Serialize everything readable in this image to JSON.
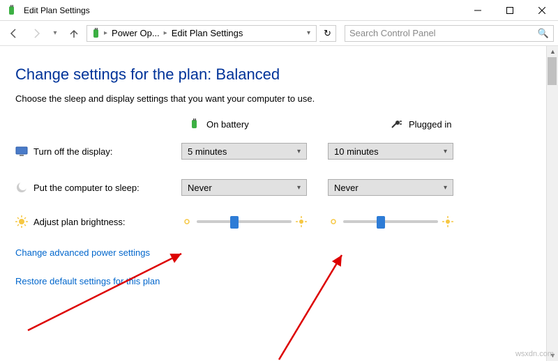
{
  "window": {
    "title": "Edit Plan Settings"
  },
  "breadcrumb": {
    "item1": "Power Op...",
    "item2": "Edit Plan Settings"
  },
  "search": {
    "placeholder": "Search Control Panel"
  },
  "heading": "Change settings for the plan: Balanced",
  "subtext": "Choose the sleep and display settings that you want your computer to use.",
  "columns": {
    "battery": "On battery",
    "plugged": "Plugged in"
  },
  "rows": {
    "display": {
      "label": "Turn off the display:",
      "battery": "5 minutes",
      "plugged": "10 minutes"
    },
    "sleep": {
      "label": "Put the computer to sleep:",
      "battery": "Never",
      "plugged": "Never"
    },
    "brightness": {
      "label": "Adjust plan brightness:"
    }
  },
  "links": {
    "advanced": "Change advanced power settings",
    "restore": "Restore default settings for this plan"
  },
  "watermark": "wsxdn.com"
}
